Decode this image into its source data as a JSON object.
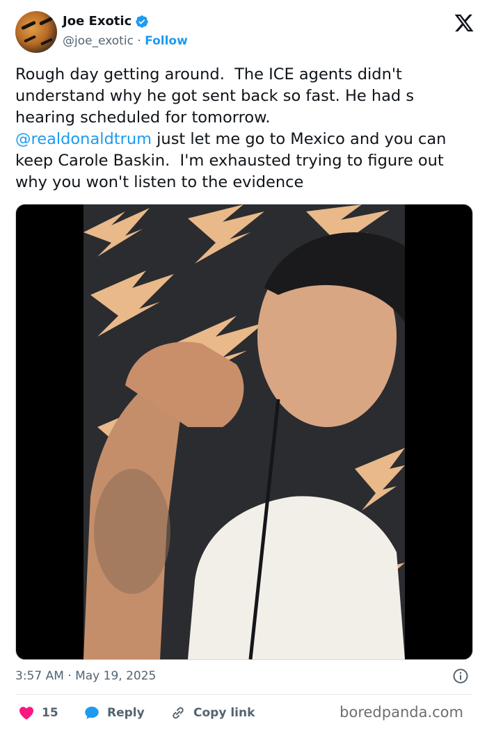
{
  "author": {
    "name": "Joe Exotic",
    "handle": "@joe_exotic",
    "separator": "·",
    "follow_label": "Follow"
  },
  "tweet": {
    "text_part1": "Rough day getting around.  The ICE agents didn't understand why he got sent back so fast. He had s hearing scheduled for tomorrow.",
    "mention": "@realdonaldtrum",
    "text_part2": " just let me go to Mexico and you can keep Carole Baskin.  I'm exhausted trying to figure out why you won't listen to the evidence"
  },
  "meta": {
    "timestamp": "3:57 AM · May 19, 2025"
  },
  "actions": {
    "like_count": "15",
    "reply_label": "Reply",
    "copy_link_label": "Copy link"
  },
  "watermark": "boredpanda.com",
  "colors": {
    "link": "#1d9bf0",
    "like": "#f91880",
    "reply": "#1d9bf0",
    "verified": "#1d9bf0",
    "backdrop_bolts": "#e9b98a"
  },
  "icons": [
    "verified-icon",
    "x-logo-icon",
    "info-icon",
    "heart-icon",
    "reply-bubble-icon",
    "link-icon"
  ]
}
